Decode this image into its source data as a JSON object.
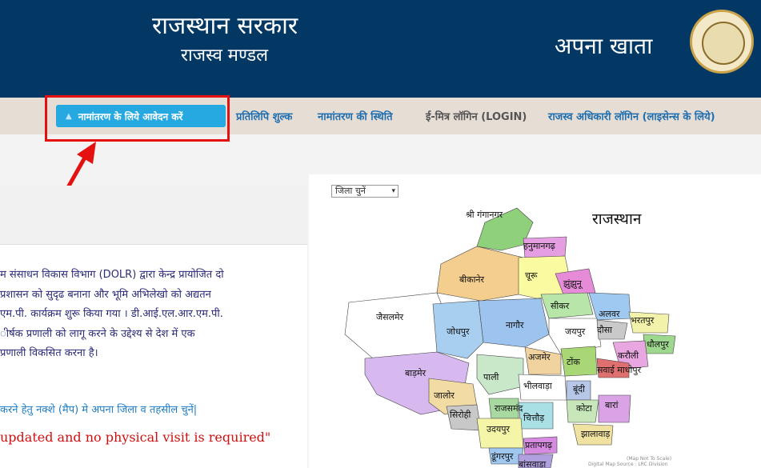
{
  "header": {
    "title": "राजस्थान सरकार",
    "subtitle": "राजस्व मण्डल",
    "app_name": "अपना खाता"
  },
  "nav": {
    "apply_button": "नामांतरण के लिये आवेदन करें",
    "links": [
      "प्रतिलिपि शुल्क",
      "नामांतरण की स्थिति",
      "ई-मित्र लॉगिन (LOGIN)",
      "राजस्व अधिकारी लॉगिन (लाइसेन्स के लिये)"
    ]
  },
  "panel": {
    "paragraph_lines": [
      "म संसाधन विकास विभाग (DOLR) द्वारा केन्द्र प्रायोजित दो",
      " प्रशासन को सुदृढ बनाना और भूमि अभिलेखो को अद्यतन",
      "एम.पी. कार्यक्रम शुरू किया गया । डी.आई.एल.आर.एम.पी.",
      "ीर्षक प्रणाली को लागू करने के उद्देश्य से देश में एक",
      "प्रणाली विकसित करना है।"
    ],
    "hint": "करने हेतु नक्शे (मैप) मे अपना जिला व तहसील चुनें|",
    "notice": "updated and no physical visit is required\""
  },
  "map": {
    "select_value": "जिला चुनें",
    "title": "राजस्थान",
    "credit_lines": [
      "(Map Not To Scale)",
      "Digital Map Source : LRC Division"
    ],
    "districts": [
      "श्री गंगानगर",
      "हनुमानगढ़",
      "बीकानेर",
      "चूरू",
      "झुंझुनू",
      "सीकर",
      "अलवर",
      "भरतपुर",
      "धौलपुर",
      "जैसलमेर",
      "जोधपुर",
      "नागौर",
      "जयपुर",
      "दौसा",
      "करौली",
      "सवाई माधोपुर",
      "अजमेर",
      "टोंक",
      "बाड़मेर",
      "पाली",
      "भीलवाड़ा",
      "बूंदी",
      "जालोर",
      "सिरोही",
      "राजसमंद",
      "चित्तौड़",
      "कोटा",
      "बारां",
      "उदयपुर",
      "प्रतापगढ़",
      "झालावाड़",
      "डूंगरपुर",
      "बांसवाड़ा"
    ]
  }
}
